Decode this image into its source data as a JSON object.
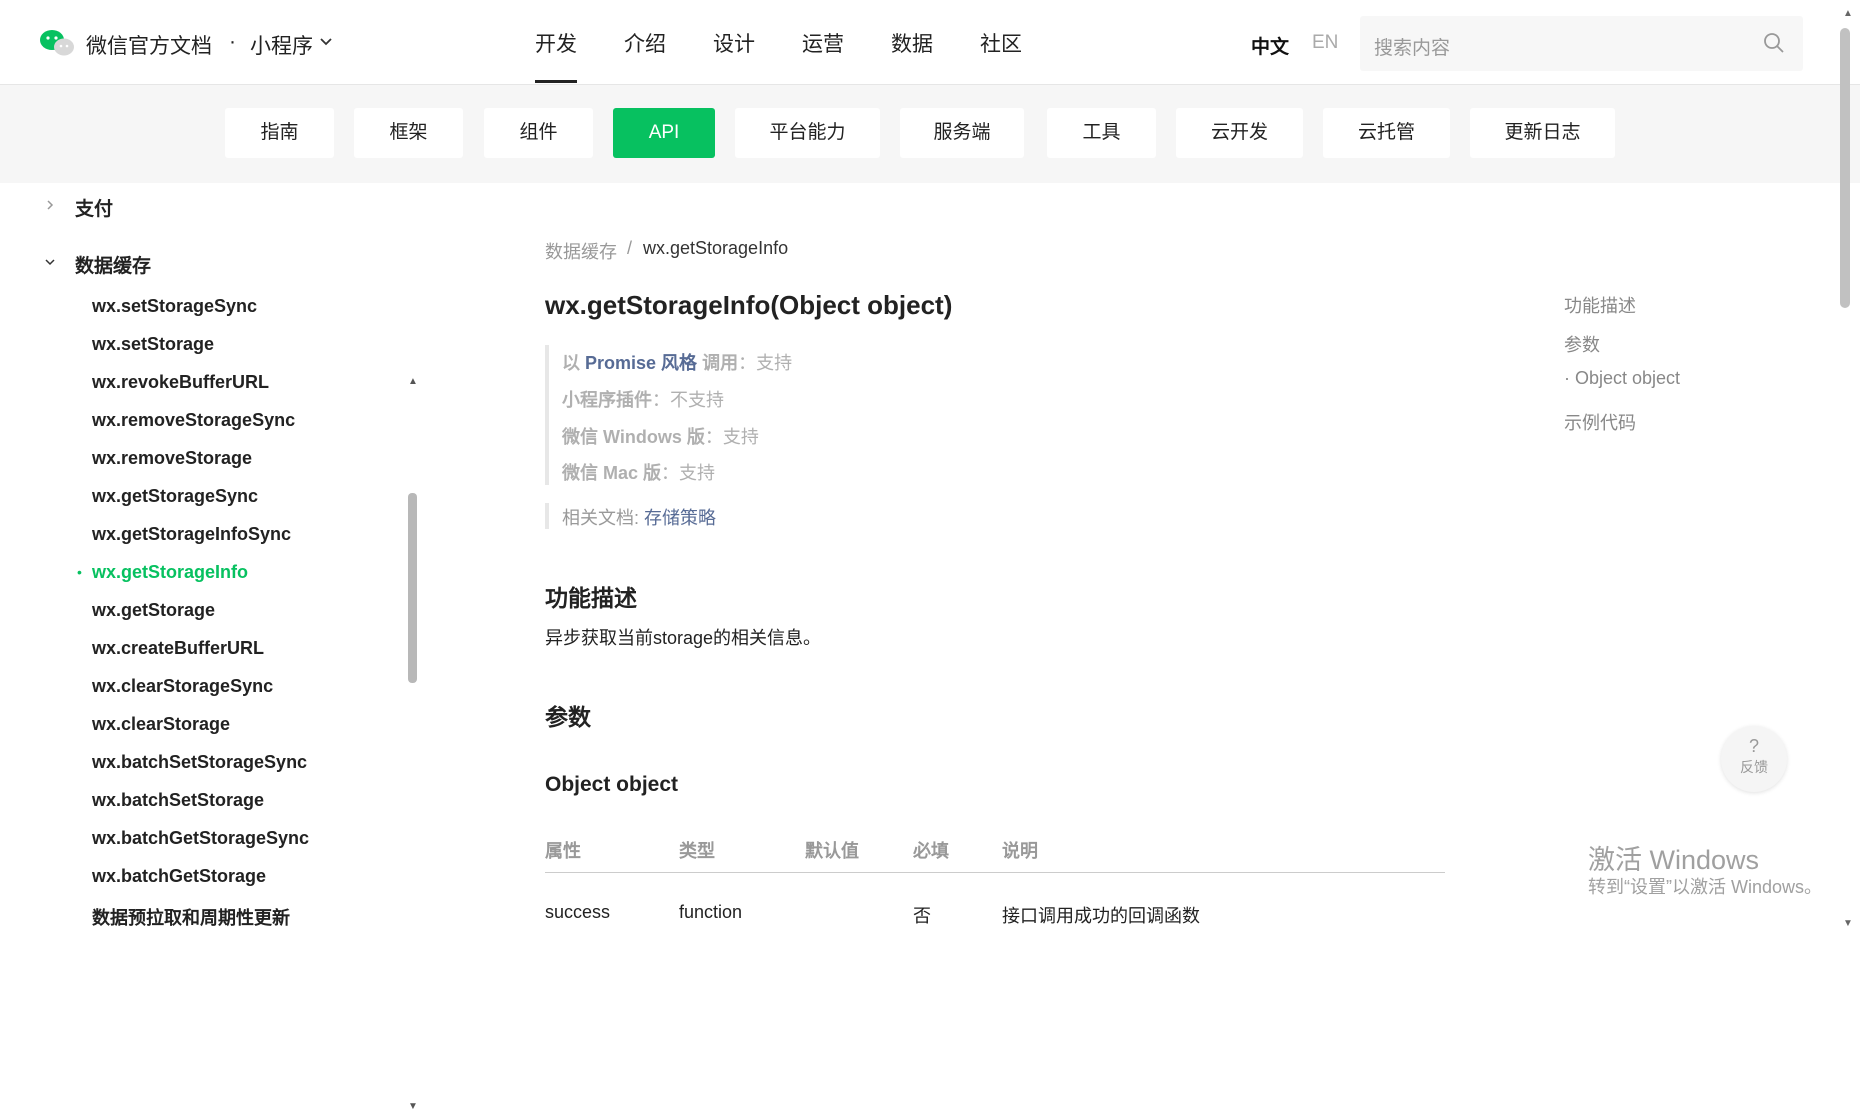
{
  "header": {
    "brand": "微信官方文档",
    "dot": "·",
    "product": "小程序",
    "nav": [
      "开发",
      "介绍",
      "设计",
      "运营",
      "数据",
      "社区"
    ],
    "active_nav": "开发",
    "lang_zh": "中文",
    "lang_en": "EN",
    "search_placeholder": "搜索内容"
  },
  "subnav": {
    "tabs": [
      "指南",
      "框架",
      "组件",
      "API",
      "平台能力",
      "服务端",
      "工具",
      "云开发",
      "云托管",
      "更新日志"
    ],
    "active": "API"
  },
  "sidebar": {
    "group_pay": "支付",
    "group_storage": "数据缓存",
    "items": [
      "wx.setStorageSync",
      "wx.setStorage",
      "wx.revokeBufferURL",
      "wx.removeStorageSync",
      "wx.removeStorage",
      "wx.getStorageSync",
      "wx.getStorageInfoSync",
      "wx.getStorageInfo",
      "wx.getStorage",
      "wx.createBufferURL",
      "wx.clearStorageSync",
      "wx.clearStorage",
      "wx.batchSetStorageSync",
      "wx.batchSetStorage",
      "wx.batchGetStorageSync",
      "wx.batchGetStorage",
      "数据预拉取和周期性更新"
    ],
    "active_item": "wx.getStorageInfo",
    "bullet": "•"
  },
  "breadcrumb": {
    "parent": "数据缓存",
    "sep": "/",
    "current": "wx.getStorageInfo"
  },
  "content": {
    "title": "wx.getStorageInfo(Object object)",
    "support": {
      "promise_prefix": "以",
      "promise_link": "Promise 风格",
      "promise_suffix": "调用",
      "promise_value": "：支持",
      "plugin_label": "小程序插件",
      "plugin_value": "：不支持",
      "windows_label": "微信 Windows 版",
      "windows_value": "：支持",
      "mac_label": "微信 Mac 版",
      "mac_value": "：支持"
    },
    "related_label": "相关文档: ",
    "related_link": "存储策略",
    "section_desc": "功能描述",
    "desc_text": "异步获取当前storage的相关信息。",
    "section_params": "参数",
    "object_heading": "Object object",
    "table": {
      "headers": [
        "属性",
        "类型",
        "默认值",
        "必填",
        "说明"
      ],
      "rows": [
        [
          "success",
          "function",
          "",
          "否",
          "接口调用成功的回调函数"
        ]
      ]
    }
  },
  "toc": [
    "功能描述",
    "参数",
    "· Object object",
    "示例代码"
  ],
  "feedback": {
    "icon": "?",
    "label": "反馈"
  },
  "watermark": {
    "line1": "激活 Windows",
    "line2": "转到“设置”以激活 Windows。"
  },
  "colors": {
    "accent": "#07c160",
    "link": "#576b95"
  }
}
